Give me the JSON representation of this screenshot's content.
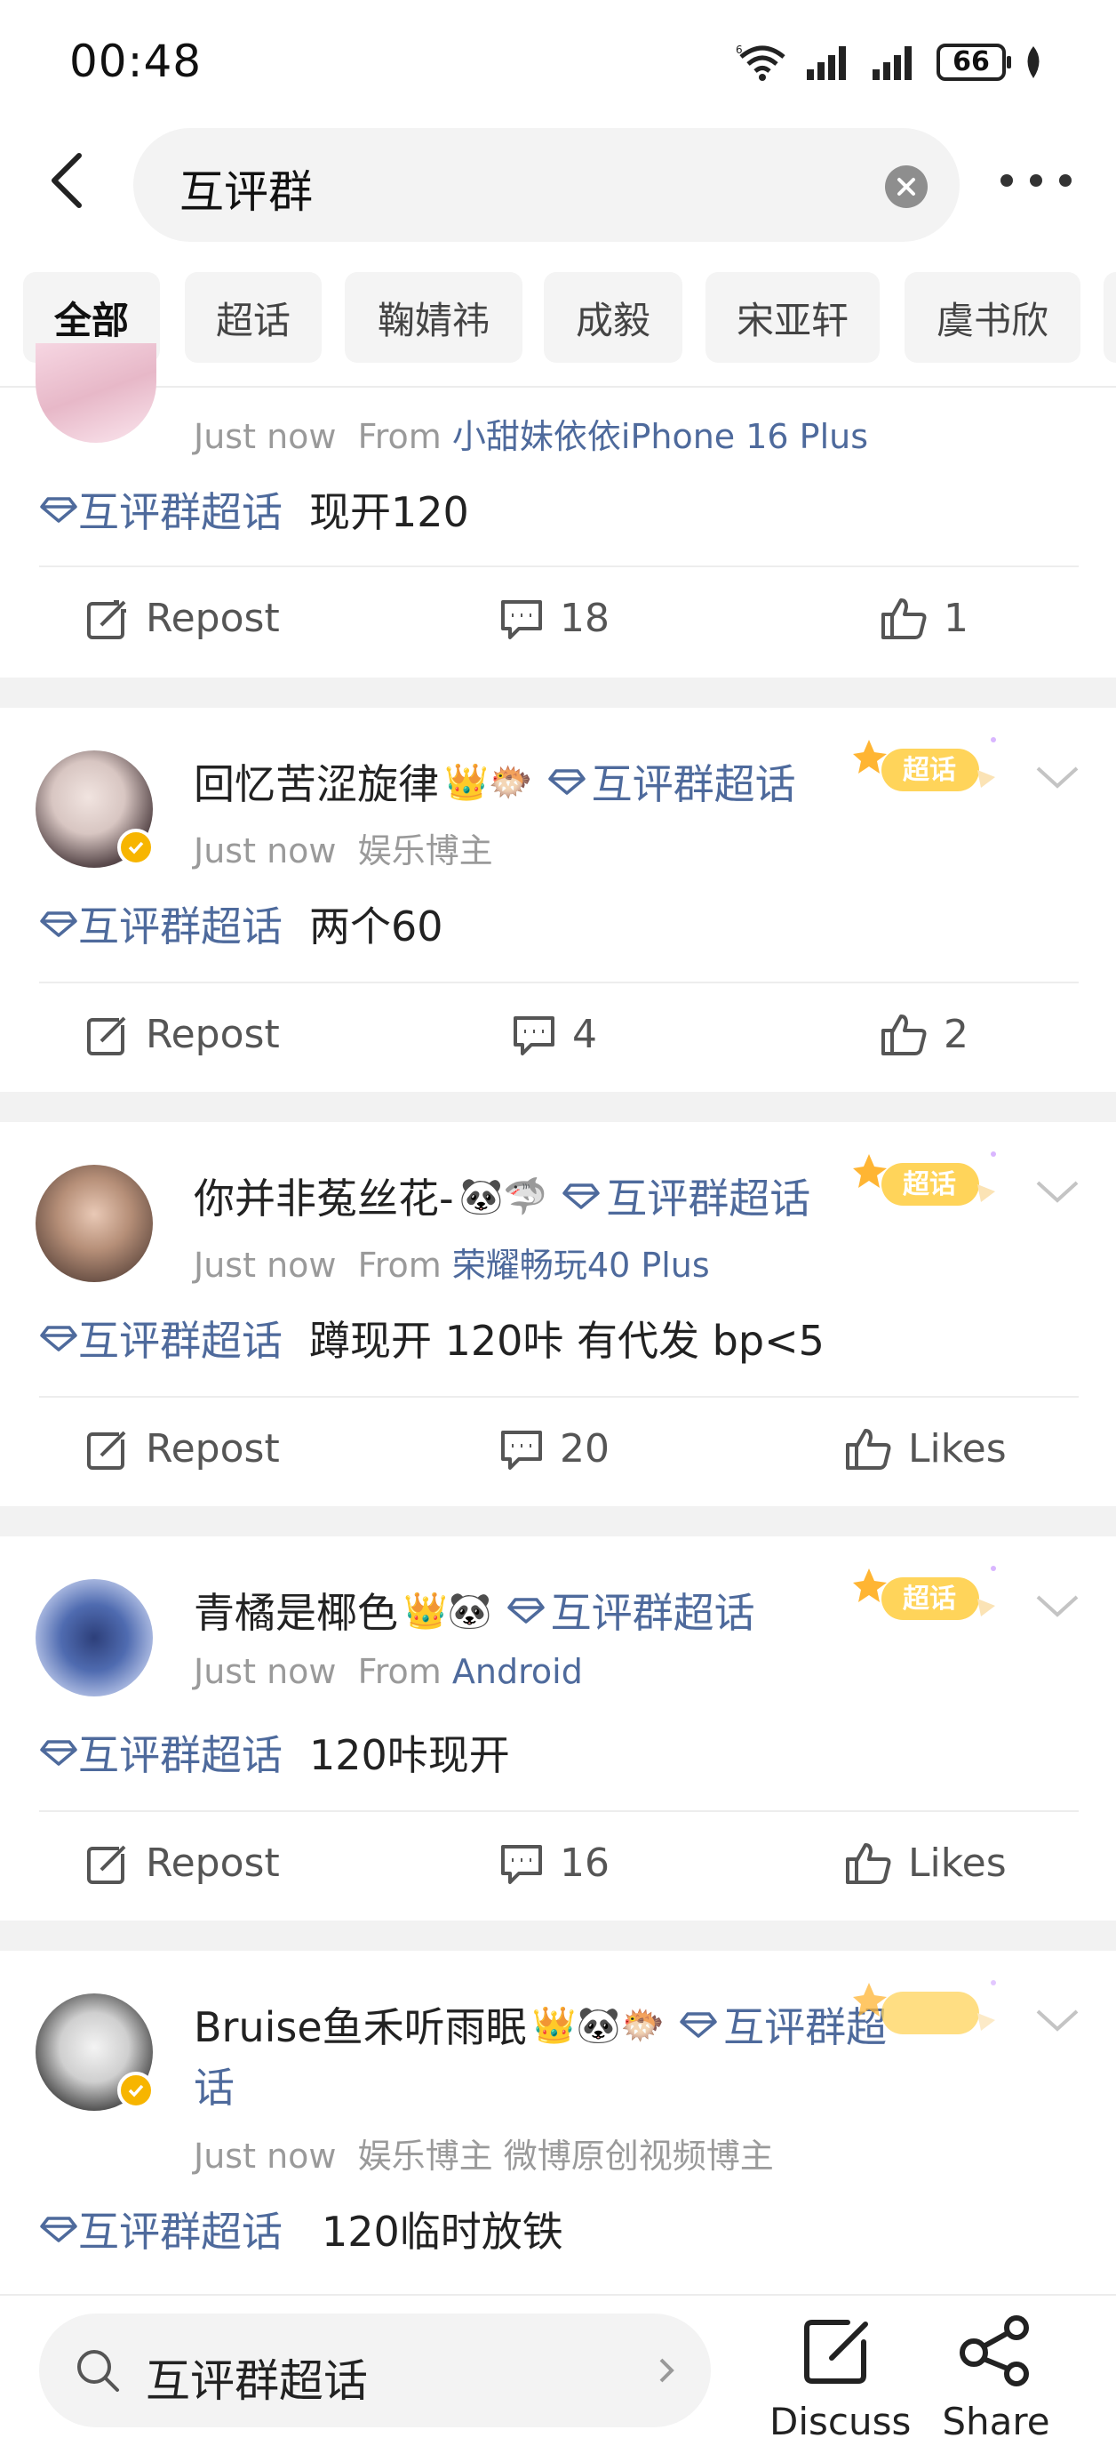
{
  "status_bar": {
    "time": "00:48",
    "battery": "66"
  },
  "header": {
    "query": "互评群"
  },
  "tabs": [
    "全部",
    "超话",
    "鞠婧祎",
    "成毅",
    "宋亚轩",
    "虞书欣"
  ],
  "topic_label": "互评群超话",
  "posts": [
    {
      "time": "Just now",
      "from_prefix": "From",
      "from": "小甜妹依依iPhone 16 Plus",
      "content": "现开120",
      "repost": "Repost",
      "comments": "18",
      "likes": "1"
    },
    {
      "name": "回忆苦涩旋律",
      "emojis": "👑🐡",
      "time": "Just now",
      "meta": "娱乐博主",
      "content": "两个60",
      "repost": "Repost",
      "comments": "4",
      "likes": "2"
    },
    {
      "name": "你并非菟丝花-",
      "emojis": "🐼🦈",
      "time": "Just now",
      "from_prefix": "From",
      "from": "荣耀畅玩40 Plus",
      "content": "蹲现开 120咔 有代发 bp<5",
      "repost": "Repost",
      "comments": "20",
      "likes": "Likes"
    },
    {
      "name": "青橘是椰色",
      "emojis": "👑🐼",
      "time": "Just now",
      "from_prefix": "From",
      "from": "Android",
      "content": "120咔现开",
      "repost": "Repost",
      "comments": "16",
      "likes": "Likes"
    },
    {
      "name": "Bruise鱼禾听雨眠",
      "emojis": "👑🐼🐡",
      "topic_line1": "互评群超",
      "topic_line2": "话",
      "time": "Just now",
      "meta": "娱乐博主 微博原创视频博主",
      "content": "120临时放铁"
    }
  ],
  "badge_text": "超话",
  "bottom_bar": {
    "search_text": "互评群超话",
    "discuss": "Discuss",
    "share": "Share"
  },
  "colors": {
    "link": "#4e6a9c",
    "badge": "#f7b500",
    "separator": "#f2f2f2"
  }
}
